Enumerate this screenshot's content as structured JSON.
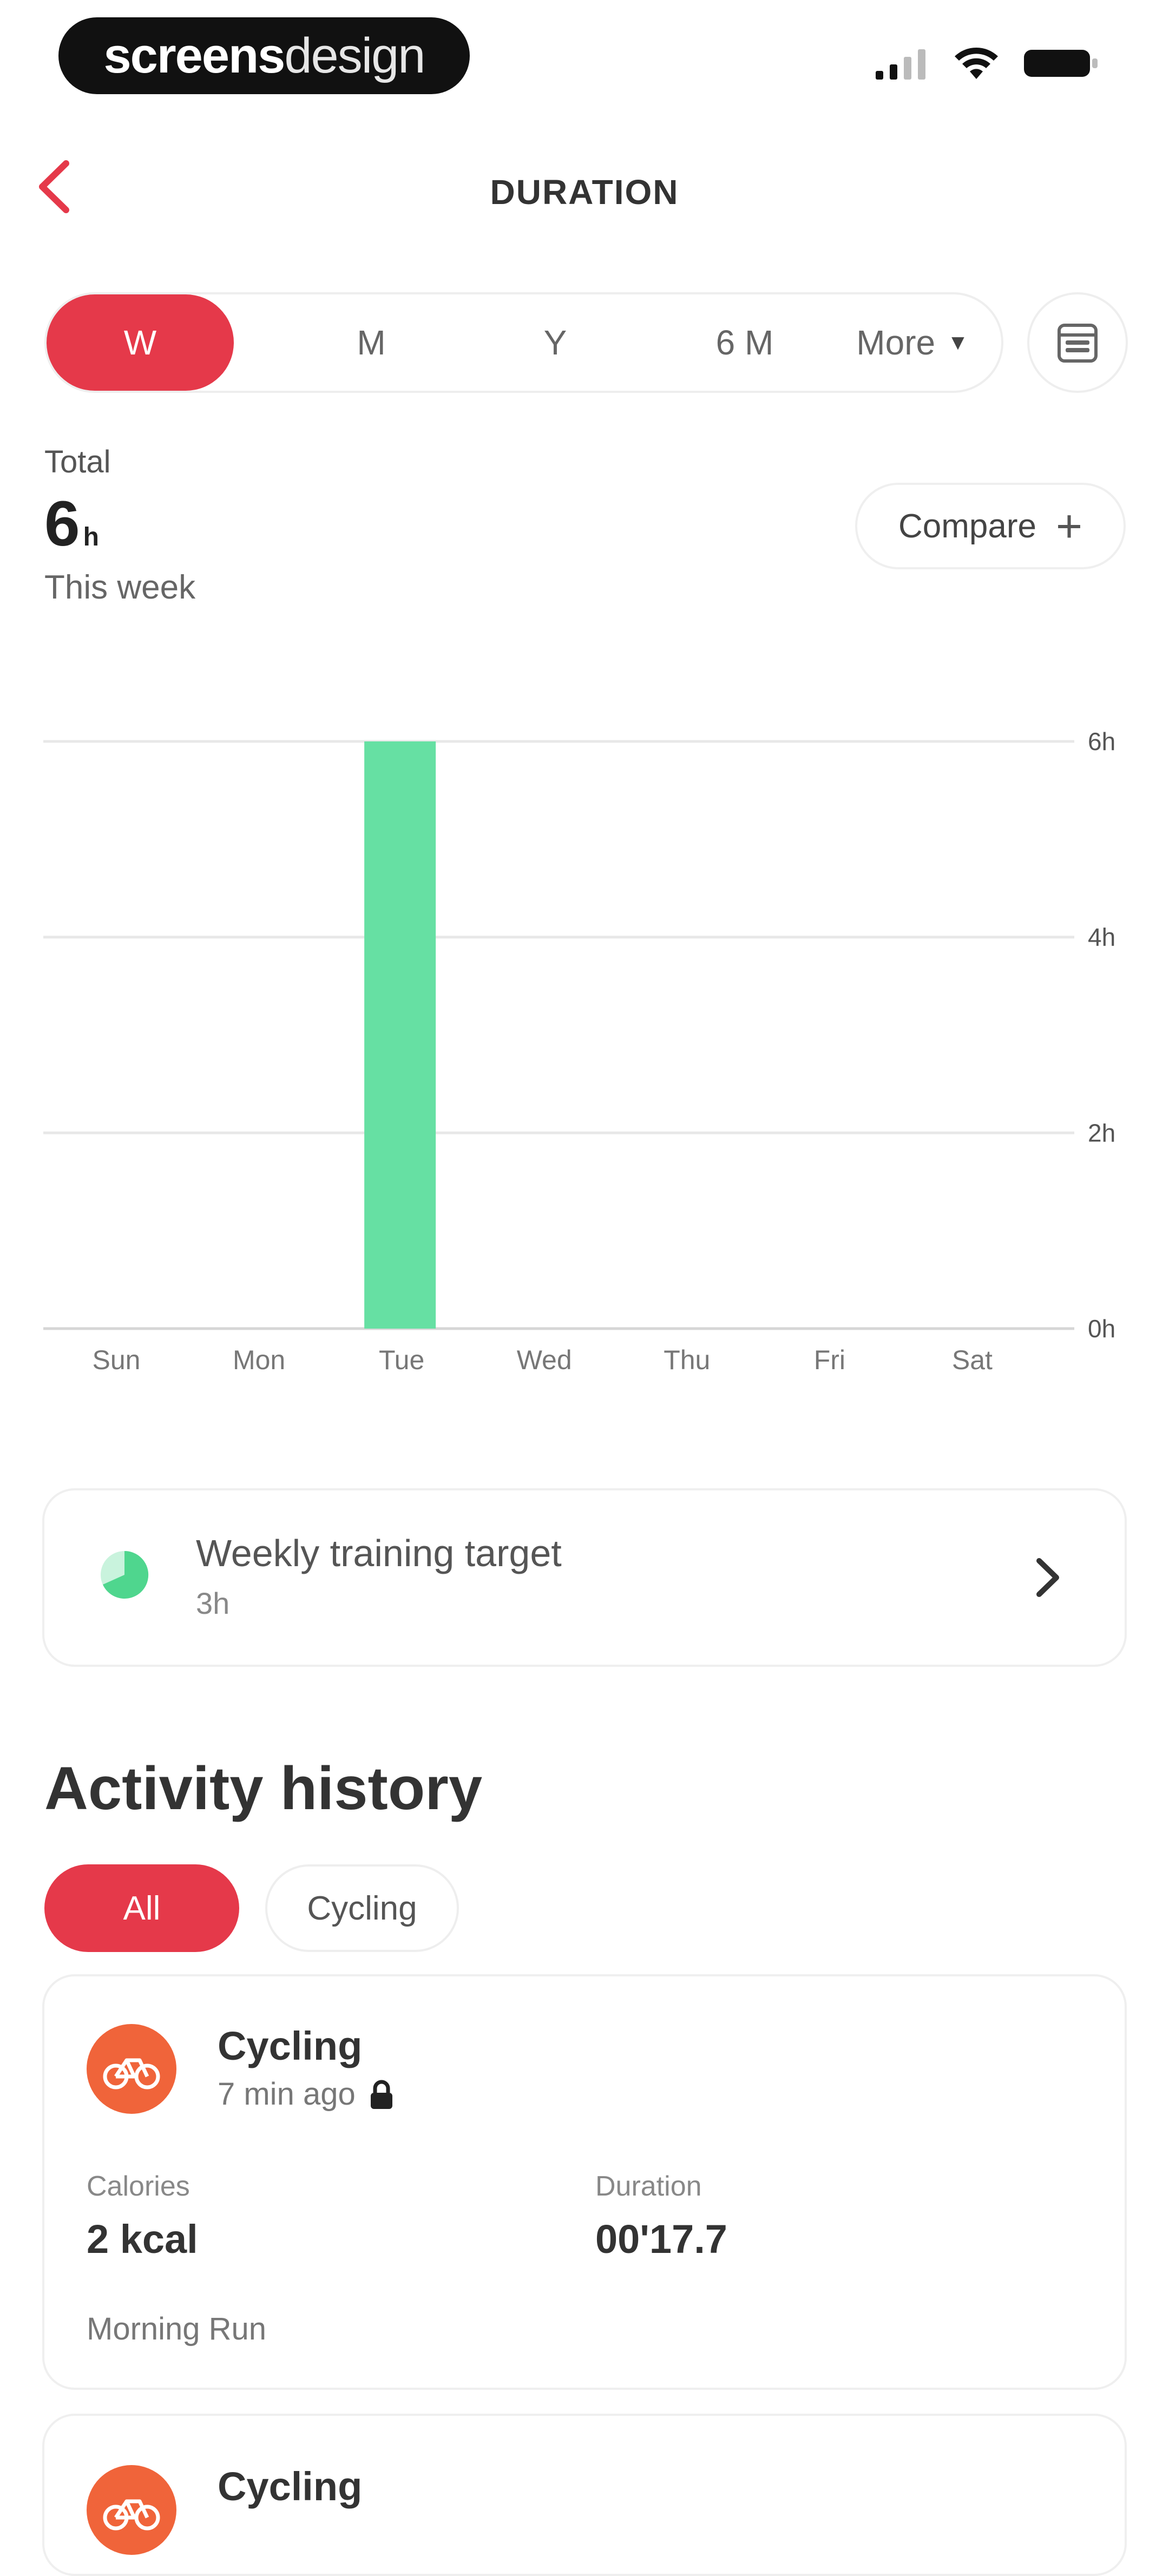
{
  "status_bar": {
    "brand_bold": "screens",
    "brand_light": "design"
  },
  "header": {
    "title": "DURATION"
  },
  "periods": {
    "items": [
      "W",
      "M",
      "Y",
      "6 M",
      "More"
    ],
    "active": "W"
  },
  "summary": {
    "total_label": "Total",
    "total_value": "6",
    "total_unit": "h",
    "period_label": "This week",
    "compare_label": "Compare"
  },
  "chart_data": {
    "type": "bar",
    "categories": [
      "Sun",
      "Mon",
      "Tue",
      "Wed",
      "Thu",
      "Fri",
      "Sat"
    ],
    "values": [
      0,
      0,
      6,
      0,
      0,
      0,
      0
    ],
    "y_ticks": [
      "6h",
      "4h",
      "2h",
      "0h"
    ],
    "ylim": [
      0,
      6
    ],
    "bar_color": "#66e0a3",
    "grid": true
  },
  "target": {
    "title": "Weekly training target",
    "subtitle": "3h"
  },
  "history": {
    "title": "Activity history",
    "filters": [
      "All",
      "Cycling"
    ],
    "activities": [
      {
        "type": "Cycling",
        "time": "7 min ago",
        "calories_label": "Calories",
        "calories_value": "2 kcal",
        "duration_label": "Duration",
        "duration_value": "00'17.7",
        "name": "Morning Run"
      },
      {
        "type": "Cycling"
      }
    ]
  },
  "colors": {
    "accent": "#e5394a",
    "bar": "#66e0a3",
    "activity_icon": "#f0643a"
  }
}
